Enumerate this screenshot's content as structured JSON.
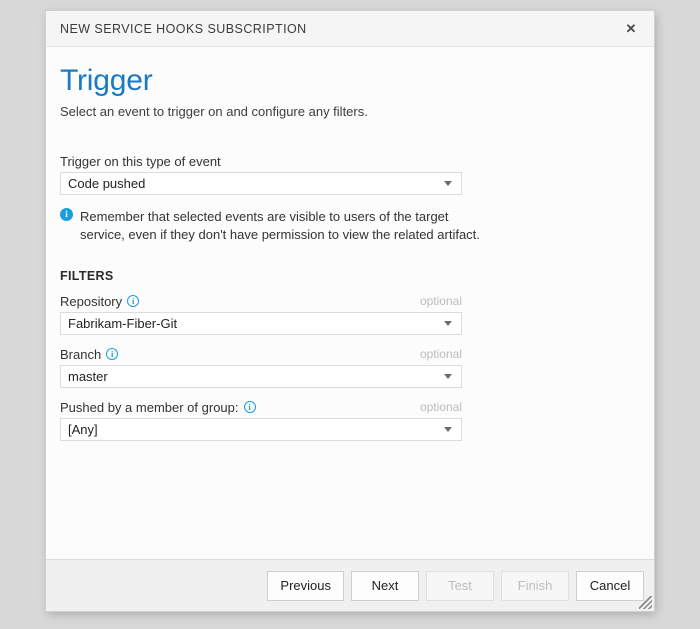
{
  "window": {
    "title": "NEW SERVICE HOOKS SUBSCRIPTION",
    "close_icon": "close-icon",
    "close_glyph": "✕",
    "resize_grip": "resize-grip"
  },
  "page": {
    "title": "Trigger",
    "subtitle": "Select an event to trigger on and configure any filters.",
    "title_color": "#1a7ac4"
  },
  "event": {
    "label": "Trigger on this type of event",
    "value": "Code pushed",
    "chevron_icon": "chevron-down-icon"
  },
  "notice": {
    "icon": "info-filled-icon",
    "icon_glyph": "i",
    "icon_color": "#1a9ce0",
    "text": "Remember that selected events are visible to users of the target service, even if they don't have permission to view the related artifact."
  },
  "filters": {
    "heading": "FILTERS",
    "optional_label": "optional",
    "optional_color": "#bcbcbc",
    "info_icon": "info-outline-icon",
    "info_glyph": "i",
    "fields": [
      {
        "label": "Repository",
        "value": "Fabrikam-Fiber-Git",
        "optional": "optional"
      },
      {
        "label": "Branch",
        "value": "master",
        "optional": "optional"
      },
      {
        "label": "Pushed by a member of group:",
        "value": "[Any]",
        "optional": "optional"
      }
    ]
  },
  "footer": {
    "buttons": [
      {
        "label": "Previous",
        "disabled": false
      },
      {
        "label": "Next",
        "disabled": false
      },
      {
        "label": "Test",
        "disabled": true
      },
      {
        "label": "Finish",
        "disabled": true
      },
      {
        "label": "Cancel",
        "disabled": false
      }
    ]
  }
}
